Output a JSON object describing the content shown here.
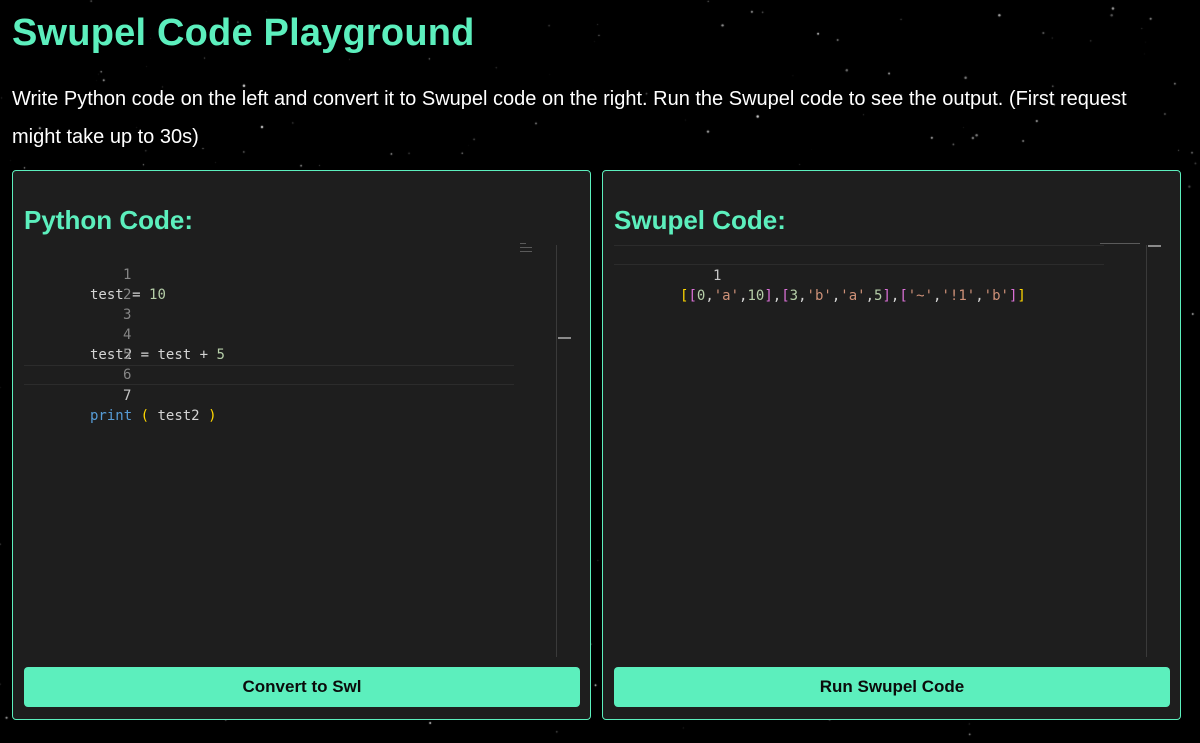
{
  "page": {
    "title": "Swupel Code Playground",
    "description": "Write Python code on the left and convert it to Swupel code on the right. Run the Swupel code to see the output. (First request might take up to 30s)"
  },
  "python_panel": {
    "title": "Python Code:",
    "line_numbers": [
      "1",
      "2",
      "3",
      "4",
      "5",
      "6",
      "7"
    ],
    "lines": {
      "l1": {
        "var": "test",
        "op": "=",
        "num": "10"
      },
      "l4": {
        "var": "test2",
        "op": "=",
        "a": "test",
        "plus": "+",
        "num": "5"
      },
      "l7": {
        "fn": "print",
        "open": "(",
        "arg": "test2",
        "close": ")"
      }
    },
    "active_line": 7,
    "button_label": "Convert to Swl"
  },
  "swupel_panel": {
    "title": "Swupel Code:",
    "line_numbers": [
      "1"
    ],
    "code": "[[0,'a',10],[3,'b','a',5],['~','!1','b']]",
    "button_label": "Run Swupel Code"
  },
  "colors": {
    "accent": "#5cefbd",
    "background": "#000000",
    "panel_bg": "#1e1e1e"
  }
}
